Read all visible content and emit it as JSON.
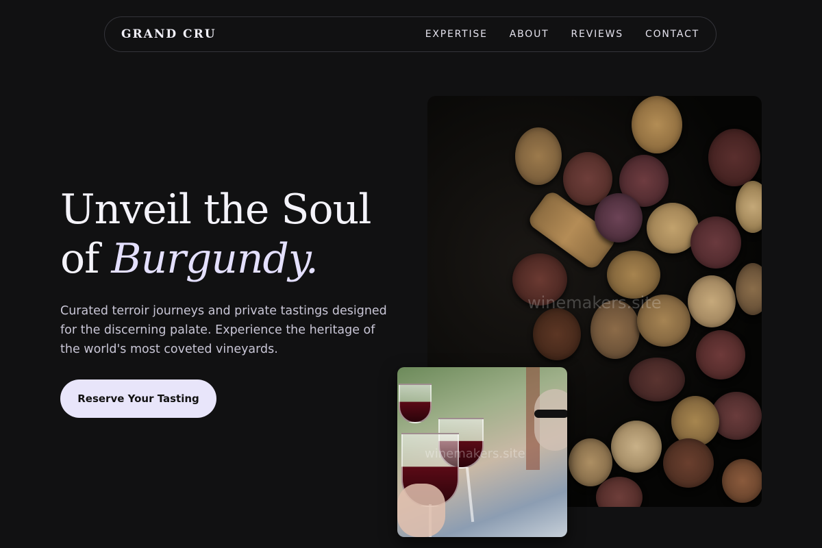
{
  "nav": {
    "brand": "GRAND CRU",
    "links": [
      "EXPERTISE",
      "ABOUT",
      "REVIEWS",
      "CONTACT"
    ]
  },
  "hero": {
    "title_line1": "Unveil the Soul",
    "title_line2_prefix": "of ",
    "title_line2_emphasis": "Burgundy.",
    "subtitle": "Curated terroir journeys and private tastings designed for the discerning palate. Experience the heritage of the world's most coveted vineyards.",
    "cta_label": "Reserve Your Tasting"
  },
  "images": {
    "watermark_text": "winemakers.site"
  },
  "colors": {
    "background": "#111112",
    "accent": "#e8e5fa",
    "emphasis": "#e4e0ff"
  }
}
